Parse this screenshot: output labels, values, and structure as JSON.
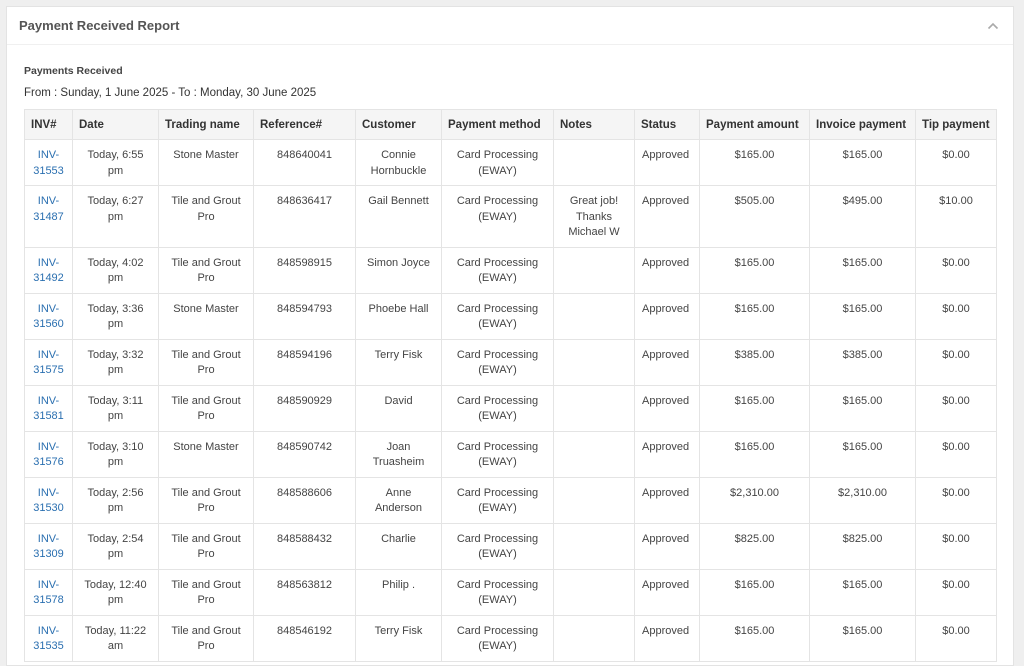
{
  "panel": {
    "title": "Payment Received Report",
    "collapse_icon": "chevron-up-icon"
  },
  "report": {
    "section_title": "Payments Received",
    "date_range": "From : Sunday, 1 June 2025 - To : Monday, 30 June 2025"
  },
  "table": {
    "headers": [
      "INV#",
      "Date",
      "Trading name",
      "Reference#",
      "Customer",
      "Payment method",
      "Notes",
      "Status",
      "Payment amount",
      "Invoice payment",
      "Tip payment"
    ],
    "rows": [
      {
        "inv": "INV-31553",
        "date": "Today, 6:55 pm",
        "trading": "Stone Master",
        "ref": "848640041",
        "customer": "Connie Hornbuckle",
        "method": "Card Processing (EWAY)",
        "notes": "",
        "status": "Approved",
        "amount": "$165.00",
        "invoice": "$165.00",
        "tip": "$0.00"
      },
      {
        "inv": "INV-31487",
        "date": "Today, 6:27 pm",
        "trading": "Tile and Grout Pro",
        "ref": "848636417",
        "customer": "Gail Bennett",
        "method": "Card Processing (EWAY)",
        "notes": "Great job! Thanks Michael W",
        "status": "Approved",
        "amount": "$505.00",
        "invoice": "$495.00",
        "tip": "$10.00"
      },
      {
        "inv": "INV-31492",
        "date": "Today, 4:02 pm",
        "trading": "Tile and Grout Pro",
        "ref": "848598915",
        "customer": "Simon Joyce",
        "method": "Card Processing (EWAY)",
        "notes": "",
        "status": "Approved",
        "amount": "$165.00",
        "invoice": "$165.00",
        "tip": "$0.00"
      },
      {
        "inv": "INV-31560",
        "date": "Today, 3:36 pm",
        "trading": "Stone Master",
        "ref": "848594793",
        "customer": "Phoebe Hall",
        "method": "Card Processing (EWAY)",
        "notes": "",
        "status": "Approved",
        "amount": "$165.00",
        "invoice": "$165.00",
        "tip": "$0.00"
      },
      {
        "inv": "INV-31575",
        "date": "Today, 3:32 pm",
        "trading": "Tile and Grout Pro",
        "ref": "848594196",
        "customer": "Terry Fisk",
        "method": "Card Processing (EWAY)",
        "notes": "",
        "status": "Approved",
        "amount": "$385.00",
        "invoice": "$385.00",
        "tip": "$0.00"
      },
      {
        "inv": "INV-31581",
        "date": "Today, 3:11 pm",
        "trading": "Tile and Grout Pro",
        "ref": "848590929",
        "customer": "David",
        "method": "Card Processing (EWAY)",
        "notes": "",
        "status": "Approved",
        "amount": "$165.00",
        "invoice": "$165.00",
        "tip": "$0.00"
      },
      {
        "inv": "INV-31576",
        "date": "Today, 3:10 pm",
        "trading": "Stone Master",
        "ref": "848590742",
        "customer": "Joan Truasheim",
        "method": "Card Processing (EWAY)",
        "notes": "",
        "status": "Approved",
        "amount": "$165.00",
        "invoice": "$165.00",
        "tip": "$0.00"
      },
      {
        "inv": "INV-31530",
        "date": "Today, 2:56 pm",
        "trading": "Tile and Grout Pro",
        "ref": "848588606",
        "customer": "Anne Anderson",
        "method": "Card Processing (EWAY)",
        "notes": "",
        "status": "Approved",
        "amount": "$2,310.00",
        "invoice": "$2,310.00",
        "tip": "$0.00"
      },
      {
        "inv": "INV-31309",
        "date": "Today, 2:54 pm",
        "trading": "Tile and Grout Pro",
        "ref": "848588432",
        "customer": "Charlie",
        "method": "Card Processing (EWAY)",
        "notes": "",
        "status": "Approved",
        "amount": "$825.00",
        "invoice": "$825.00",
        "tip": "$0.00"
      },
      {
        "inv": "INV-31578",
        "date": "Today, 12:40 pm",
        "trading": "Tile and Grout Pro",
        "ref": "848563812",
        "customer": "Philip .",
        "method": "Card Processing (EWAY)",
        "notes": "",
        "status": "Approved",
        "amount": "$165.00",
        "invoice": "$165.00",
        "tip": "$0.00"
      },
      {
        "inv": "INV-31535",
        "date": "Today, 11:22 am",
        "trading": "Tile and Grout Pro",
        "ref": "848546192",
        "customer": "Terry Fisk",
        "method": "Card Processing (EWAY)",
        "notes": "",
        "status": "Approved",
        "amount": "$165.00",
        "invoice": "$165.00",
        "tip": "$0.00"
      }
    ]
  },
  "colors": {
    "link": "#2a6fb0",
    "header_bg": "#f5f5f5",
    "border": "#e4e4e4"
  }
}
